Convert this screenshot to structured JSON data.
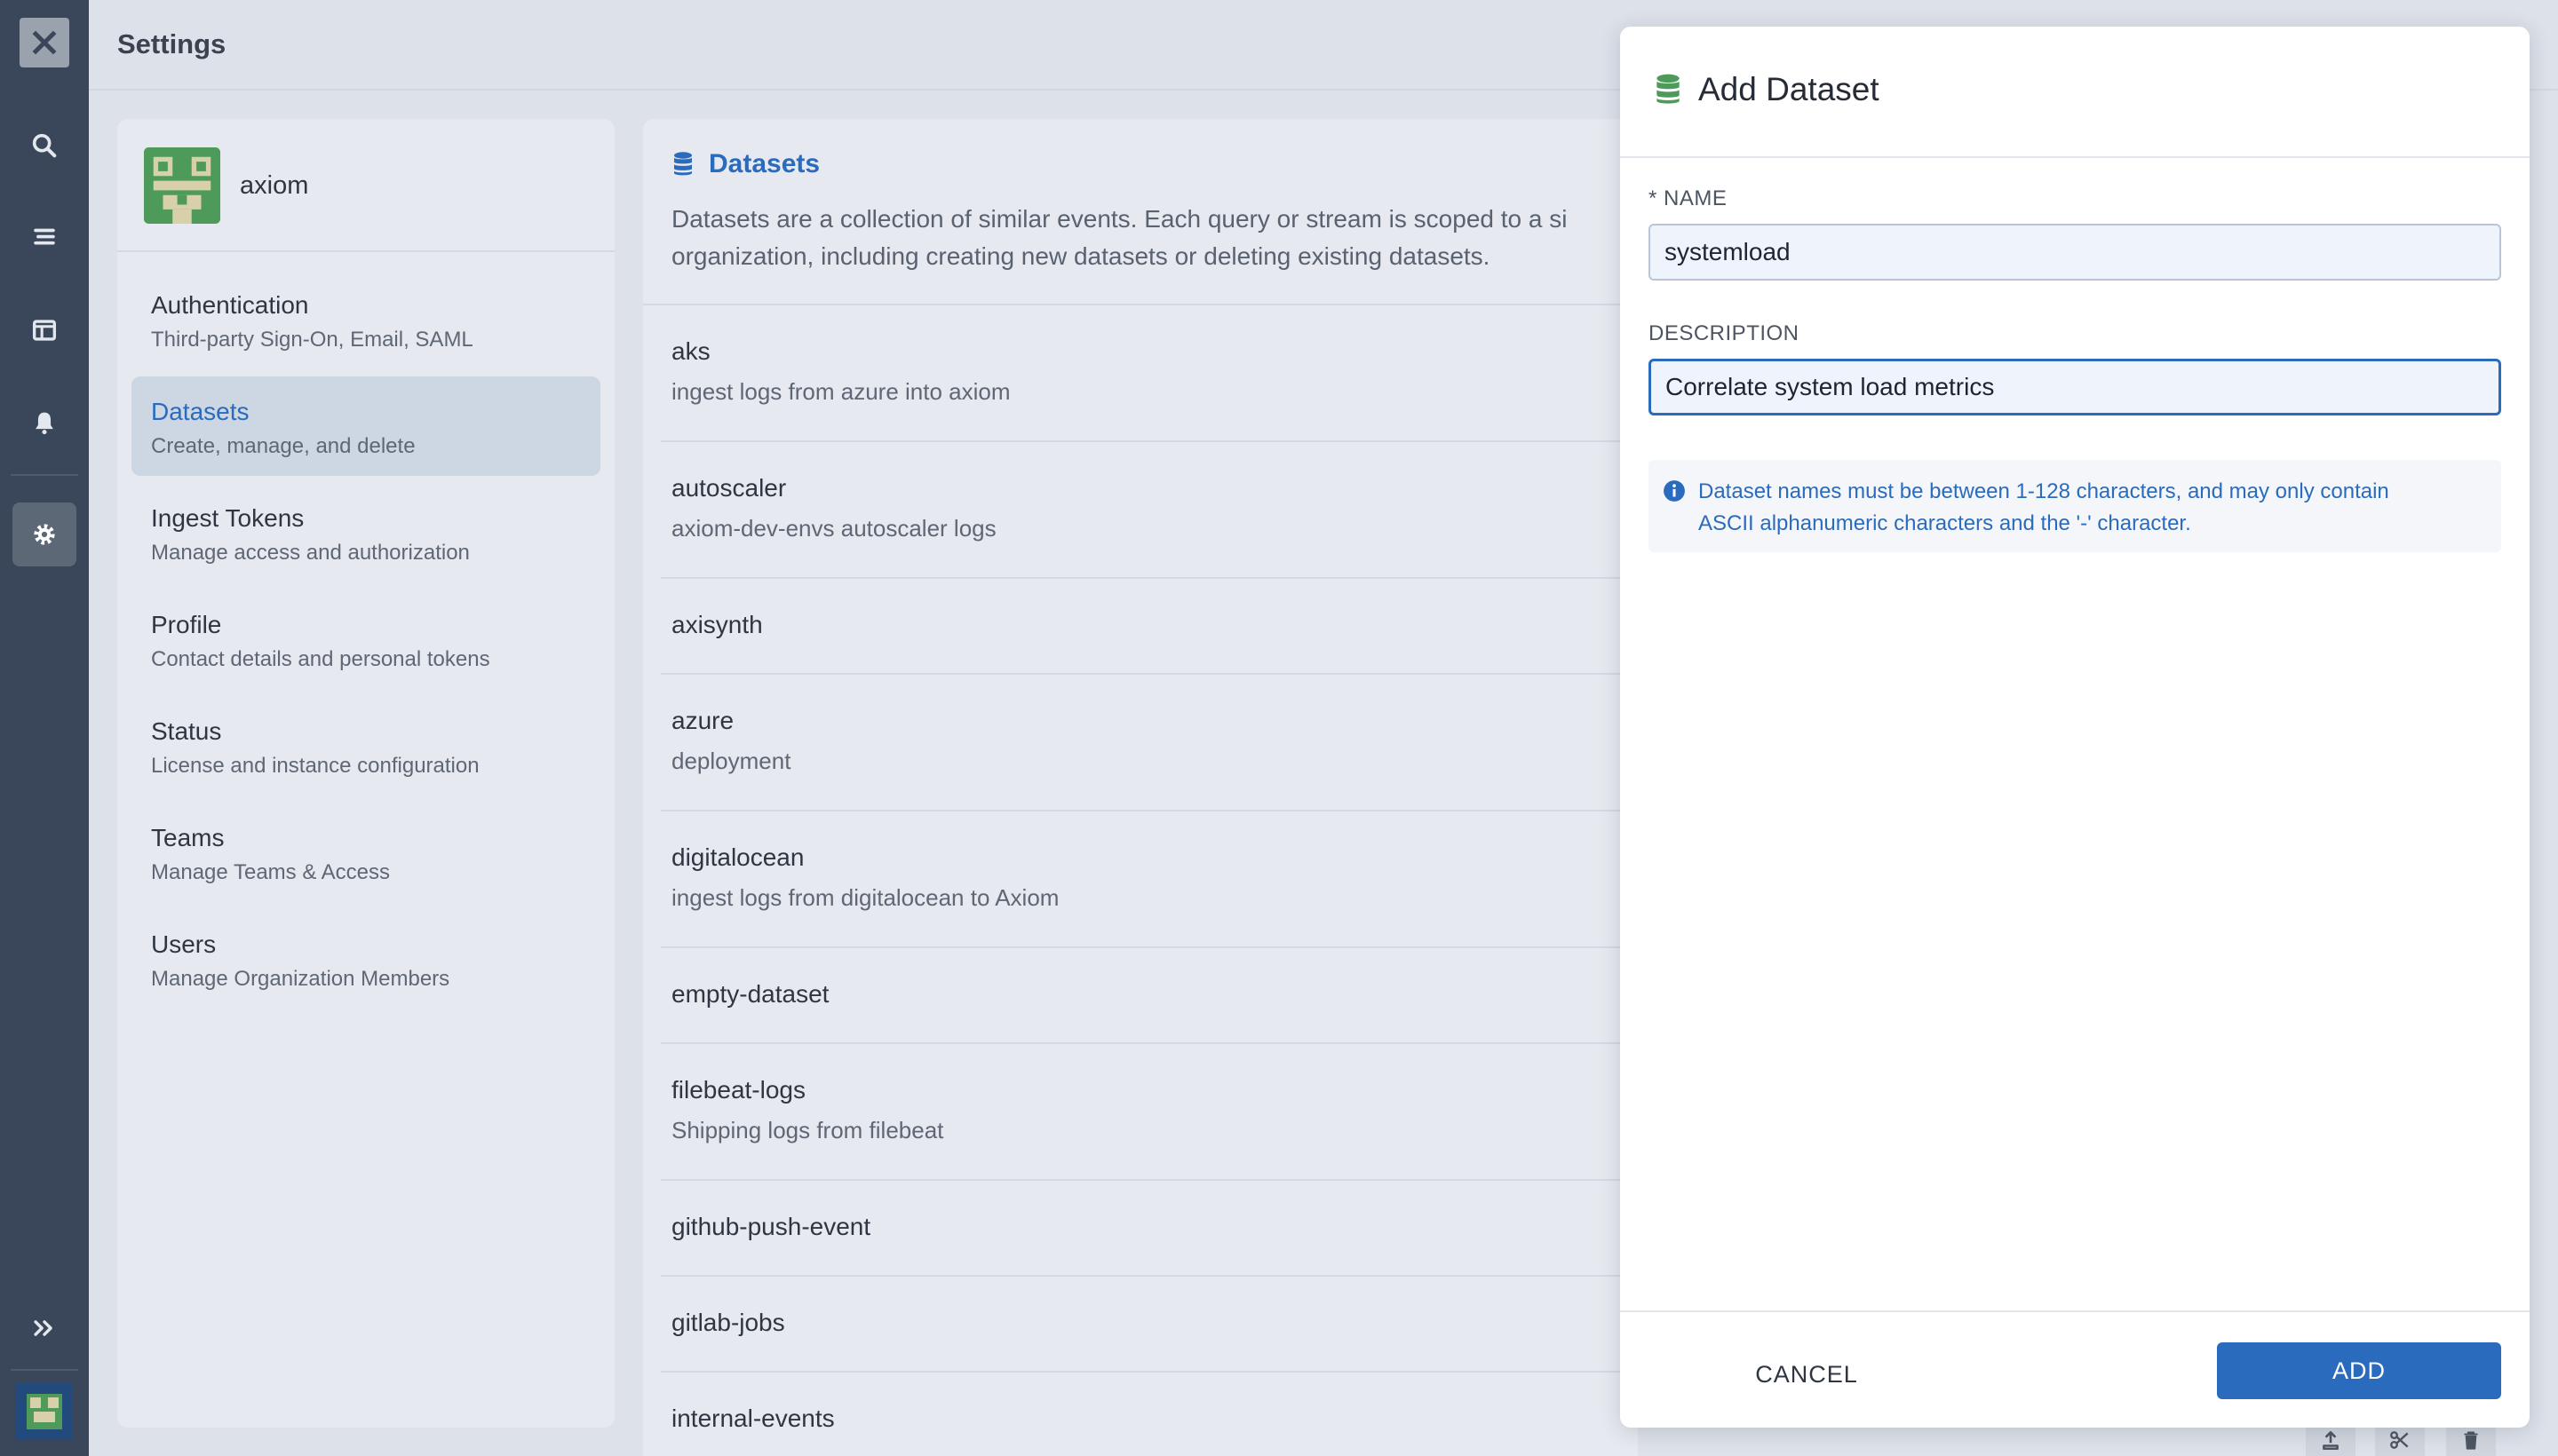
{
  "page": {
    "title": "Settings"
  },
  "rail": {
    "icons": [
      "app-logo-icon",
      "search-icon",
      "stream-icon",
      "dashboard-icon",
      "bell-icon",
      "gear-icon",
      "expand-icon"
    ]
  },
  "org": {
    "name": "axiom"
  },
  "nav": {
    "items": [
      {
        "title": "Authentication",
        "subtitle": "Third-party Sign-On, Email, SAML"
      },
      {
        "title": "Datasets",
        "subtitle": "Create, manage, and delete"
      },
      {
        "title": "Ingest Tokens",
        "subtitle": "Manage access and authorization"
      },
      {
        "title": "Profile",
        "subtitle": "Contact details and personal tokens"
      },
      {
        "title": "Status",
        "subtitle": "License and instance configuration"
      },
      {
        "title": "Teams",
        "subtitle": "Manage Teams & Access"
      },
      {
        "title": "Users",
        "subtitle": "Manage Organization Members"
      }
    ],
    "active": "Datasets"
  },
  "list": {
    "title": "Datasets",
    "description_line1": "Datasets are a collection of similar events. Each query or stream is scoped to a si",
    "description_line2": "organization, including creating new datasets or deleting existing datasets.",
    "datasets": [
      {
        "name": "aks",
        "description": "ingest logs from azure into axiom"
      },
      {
        "name": "autoscaler",
        "description": "axiom-dev-envs autoscaler logs"
      },
      {
        "name": "axisynth",
        "description": ""
      },
      {
        "name": "azure",
        "description": "deployment"
      },
      {
        "name": "digitalocean",
        "description": "ingest logs from digitalocean to Axiom"
      },
      {
        "name": "empty-dataset",
        "description": ""
      },
      {
        "name": "filebeat-logs",
        "description": "Shipping logs from filebeat"
      },
      {
        "name": "github-push-event",
        "description": ""
      },
      {
        "name": "gitlab-jobs",
        "description": ""
      },
      {
        "name": "internal-events",
        "description": ""
      }
    ]
  },
  "modal": {
    "title": "Add Dataset",
    "name_label": "* NAME",
    "name_value": "systemload",
    "description_label": "DESCRIPTION",
    "description_value": "Correlate system load metrics ",
    "info_text_line1": "Dataset names must be between 1-128 characters, and may only contain",
    "info_text_line2": "ASCII alphanumeric characters and the '-' character.",
    "cancel_label": "CANCEL",
    "add_label": "ADD"
  },
  "colors": {
    "accent": "#2a6bbd",
    "rail_bg": "#3a4659",
    "page_bg": "#dde1e9",
    "dataset_icon_green": "#4e9a5a"
  }
}
